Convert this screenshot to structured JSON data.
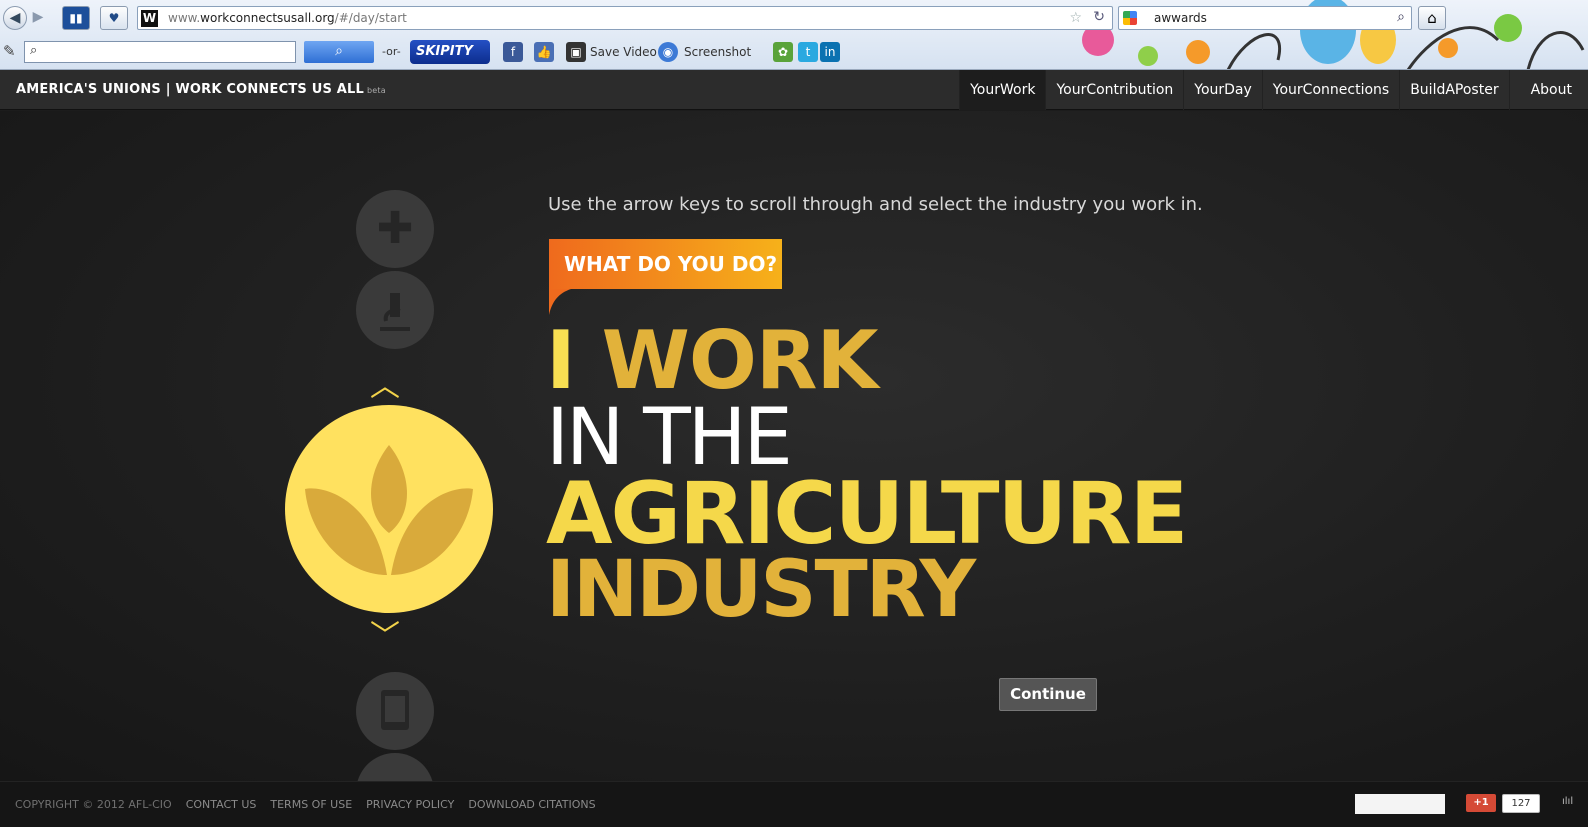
{
  "browser": {
    "url_prefix": "www.",
    "url_domain": "workconnectsusall.org",
    "url_path": "/#/day/start",
    "search_query": "awwards",
    "toolbar_or": "-or-",
    "skipity_label": "SKIPITY",
    "save_video_label": "Save Video",
    "screenshot_label": "Screenshot"
  },
  "site_header": {
    "brand": "AMERICA'S UNIONS | WORK CONNECTS US ALL",
    "beta": "beta",
    "nav": [
      "YourWork",
      "YourContribution",
      "YourDay",
      "YourConnections",
      "BuildAPoster",
      "About"
    ]
  },
  "main": {
    "instructions": "Use the arrow keys to scroll through and select the industry you work in.",
    "tag": "WHAT DO YOU DO?",
    "headline_i": "I",
    "headline_work": "WORK",
    "headline_in_the": "IN THE",
    "headline_industry_name": "AGRICULTURE",
    "headline_industry": "INDUSTRY",
    "continue_label": "Continue",
    "carousel_icons": [
      "medical-cross-icon",
      "microscope-icon",
      "agriculture-leaf-icon",
      "tablet-icon"
    ],
    "accent_colors": {
      "yellow": "#f5d84a",
      "gold": "#e2b23a",
      "orange": "#ef6a1d"
    }
  },
  "footer": {
    "links": [
      "COPYRIGHT © 2012 AFL-CIO",
      "CONTACT US",
      "TERMS OF USE",
      "PRIVACY POLICY",
      "DOWNLOAD CITATIONS"
    ],
    "gplus_label": "+1",
    "gplus_count": "127"
  }
}
